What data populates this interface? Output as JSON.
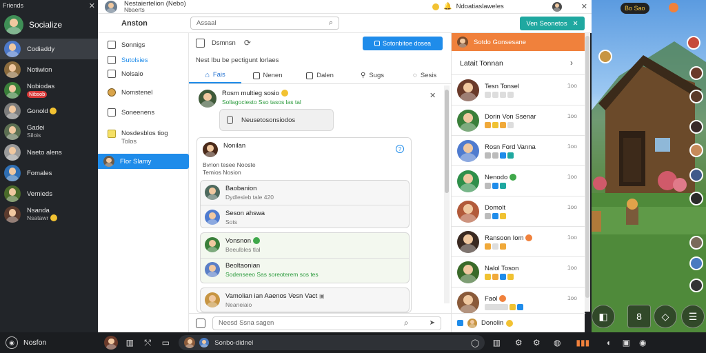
{
  "left_sidebar": {
    "title": "Friends",
    "profile_name": "Socialize",
    "friends": [
      {
        "name": "Codiaddy",
        "sub": ""
      },
      {
        "name": "Notiwion",
        "sub": ""
      },
      {
        "name": "Nobiodas",
        "sub": ""
      },
      {
        "name": "Gonold",
        "sub": ""
      },
      {
        "name": "Gadei",
        "sub": "Silois"
      },
      {
        "name": "Naeto alens",
        "sub": ""
      },
      {
        "name": "Fomales",
        "sub": ""
      },
      {
        "name": "Vernieds",
        "sub": ""
      },
      {
        "name": "Nsanda",
        "sub": "Nsatawr"
      }
    ],
    "badge": "Nibsob",
    "bottom_label": "Nosfon"
  },
  "window_bar": {
    "title": "Nestaiertelion (Nebo)",
    "subtitle": "Nbaerts",
    "notice": "Ndoatiaslaweles"
  },
  "app_header": {
    "logo": "Anston",
    "search_placeholder": "Assaal",
    "cta": "Ven Seonetos"
  },
  "nav": {
    "items": [
      "Sonnigs",
      "Sutolsies",
      "Nolsaio",
      "Nomstenel",
      "Soneenens",
      "Nosdesblos tiog",
      "Flor Slamy"
    ],
    "items_sub": [
      "",
      "",
      "",
      "",
      "",
      "Tolos",
      ""
    ]
  },
  "main": {
    "header_label": "Dsmnsn",
    "blue_button": "Sotonbitoe dosea",
    "prompt": "Nest Ibu be pectigunt lorlaes",
    "tabs": [
      "Fais",
      "Nenen",
      "Dalen",
      "Sugs",
      "Sesis"
    ],
    "post": {
      "name": "Rosm multieg sosio",
      "status": "Sollagociesto Sso tasos las tal",
      "pill": "Neusetosonsiodos"
    },
    "card": {
      "name": "Nonilan",
      "line2": "Bvrion tesee Nooste",
      "line3": "Temios Nosion"
    },
    "threads": [
      {
        "name": "Baobanion",
        "sub": "Dydlesieb tale 420"
      },
      {
        "name": "Seson ahswa",
        "sub": "Sots"
      },
      {
        "name": "Vonsnon",
        "sub": "Beeulbles tlal"
      },
      {
        "name": "Beoltaonian",
        "sub": "Sodenseeo Sas soreoterem sos tes"
      },
      {
        "name": "Vamolian ian Aaenos Vesn Vact",
        "sub": "Neaneiaio"
      }
    ],
    "composer_placeholder": "Neesd Ssna sagen"
  },
  "right_panel": {
    "header": "Sotdo Gonsesane",
    "title": "Latait Tonnan",
    "items": [
      {
        "name": "Tesn Tonsel",
        "time": "1oo"
      },
      {
        "name": "Dorin Von Ssenar",
        "time": "1oo"
      },
      {
        "name": "Rosn Ford Vanna",
        "time": "1oo"
      },
      {
        "name": "Nenodo",
        "time": "1oo"
      },
      {
        "name": "Domolt",
        "time": "1oo"
      },
      {
        "name": "Ransoon Iom",
        "time": "1oo"
      },
      {
        "name": "Nalol Toson",
        "time": "1oo"
      },
      {
        "name": "Faol",
        "time": "1oo"
      }
    ],
    "footer": "Donolin"
  },
  "game": {
    "score": "Bo Sao"
  },
  "taskbar": {
    "search": "Sonbo-didnel"
  },
  "colors": {
    "accent": "#1f8cea",
    "orange": "#f0813c",
    "teal": "#1fa8a0",
    "green": "#2e9c3f",
    "dark": "#222529"
  }
}
